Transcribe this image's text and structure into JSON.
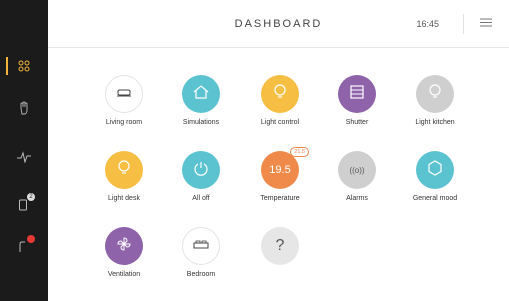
{
  "header": {
    "title": "DASHBOARD",
    "time": "16:45"
  },
  "sidebar": {
    "items": [
      {
        "name": "dashboard-icon",
        "active": true
      },
      {
        "name": "hand-icon"
      },
      {
        "name": "activity-icon"
      },
      {
        "name": "device-icon",
        "badge": "2"
      },
      {
        "name": "alert-icon",
        "badge": ""
      }
    ],
    "accent": "#f2b53b",
    "badge_colors": [
      "#dddddd",
      "#e53935"
    ]
  },
  "tiles": [
    {
      "label": "Living room",
      "icon": "sofa-icon",
      "color": "#ffffff"
    },
    {
      "label": "Simulations",
      "icon": "house-icon",
      "color": "#5bc3cf"
    },
    {
      "label": "Light control",
      "icon": "bulb-icon",
      "color": "#f6be43"
    },
    {
      "label": "Shutter",
      "icon": "shutter-icon",
      "color": "#8e63a9"
    },
    {
      "label": "Light kitchen",
      "icon": "bulb-icon",
      "color": "#cfcfcf"
    },
    {
      "label": "Light desk",
      "icon": "bulb-icon",
      "color": "#f6be43"
    },
    {
      "label": "All off",
      "icon": "power-icon",
      "color": "#5bc3cf"
    },
    {
      "label": "Temperature",
      "value": "19.5",
      "badge": "21.5",
      "color": "#f08a4b"
    },
    {
      "label": "Alarms",
      "text": "((o))",
      "color": "#cfcfcf"
    },
    {
      "label": "General mood",
      "icon": "hexagon-icon",
      "color": "#5bc3cf"
    },
    {
      "label": "Ventilation",
      "icon": "fan-icon",
      "color": "#8e63a9"
    },
    {
      "label": "Bedroom",
      "icon": "bed-icon",
      "color": "#ffffff"
    },
    {
      "label": "",
      "icon": "question-icon",
      "text": "?",
      "color": "#e6e6e6"
    }
  ]
}
